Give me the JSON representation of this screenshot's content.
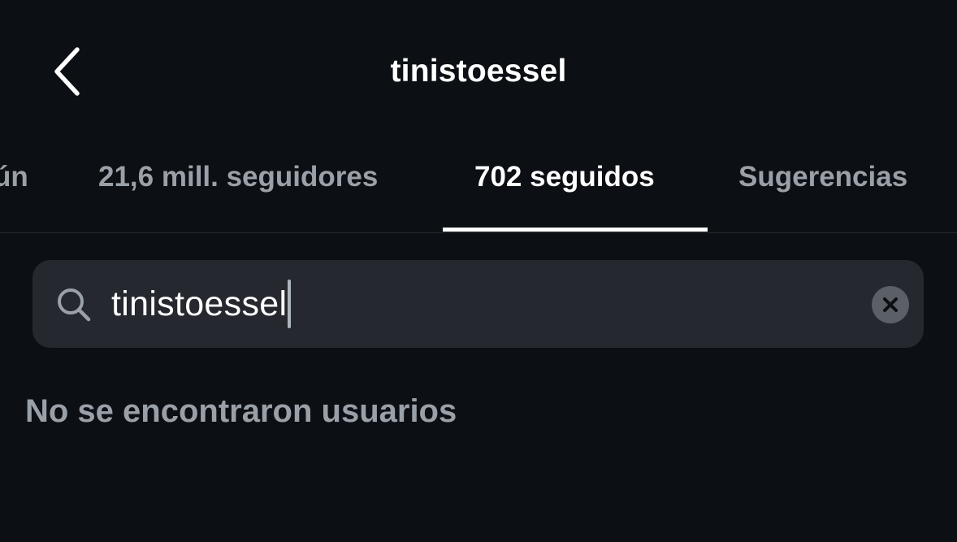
{
  "header": {
    "title": "tinistoessel",
    "back_icon": "chevron-left-icon"
  },
  "tabs": [
    {
      "label": "ún",
      "active": false
    },
    {
      "label": "21,6 mill. seguidores",
      "active": false
    },
    {
      "label": "702 seguidos",
      "active": true
    },
    {
      "label": "Sugerencias",
      "active": false
    }
  ],
  "search": {
    "value": "tinistoessel",
    "icon": "search-icon",
    "clear_icon": "close-circle-icon"
  },
  "results": {
    "empty_message": "No se encontraron usuarios"
  },
  "colors": {
    "background": "#0c0f14",
    "search_background": "#25282e",
    "text_primary": "#ffffff",
    "text_secondary": "#9aa0a8"
  }
}
